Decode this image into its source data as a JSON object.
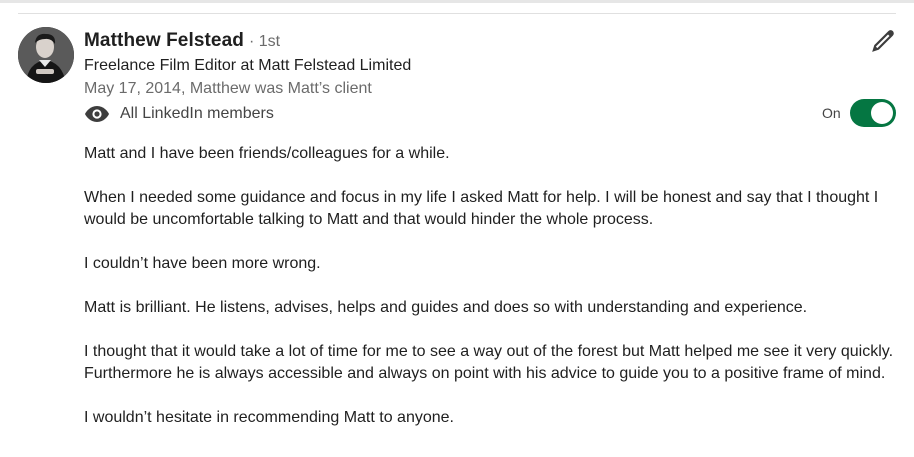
{
  "recommendation": {
    "author_name": "Matthew Felstead",
    "connection_degree": "· 1st",
    "headline": "Freelance Film Editor at Matt Felstead Limited",
    "meta": "May 17, 2014, Matthew was Matt’s client",
    "visibility": {
      "icon": "eye-icon",
      "label": "All LinkedIn members"
    },
    "toggle": {
      "label": "On",
      "state": "on",
      "color": "#057642"
    },
    "edit_icon": "pencil-icon",
    "paragraphs": [
      "Matt and I have been friends/colleagues for a while.",
      "When I needed some guidance and focus in my life I asked Matt for help. I will be honest and say that I thought I would be uncomfortable talking to Matt and that would hinder the whole process.",
      "I couldn’t have been more wrong.",
      "Matt is brilliant. He listens, advises, helps and guides and does so with understanding and experience.",
      "I thought that it would take a lot of time for me to see a way out of the forest but Matt helped me see it very quickly. Furthermore he is always accessible and always on point with his advice to guide you to a positive frame of mind.",
      "I wouldn’t hesitate in recommending Matt to anyone."
    ]
  }
}
